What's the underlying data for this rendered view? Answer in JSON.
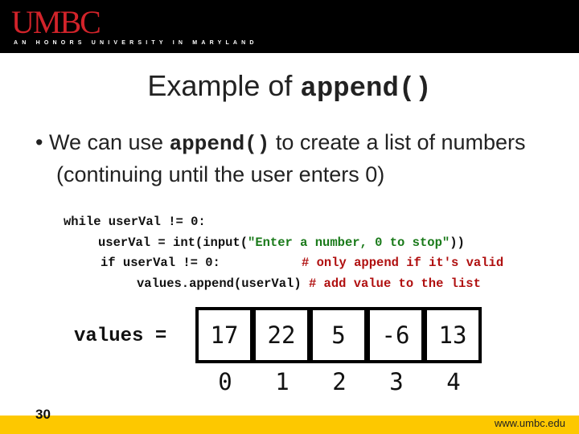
{
  "header": {
    "logo": "UMBC",
    "tagline": "AN HONORS UNIVERSITY IN MARYLAND",
    "brand_red": "#d2232a"
  },
  "title": {
    "text": "Example of ",
    "code": "append()"
  },
  "bullet": {
    "pre": "We can use ",
    "code": "append()",
    "post": " to create a list of numbers (continuing until the user enters 0)"
  },
  "code": {
    "line1": "while userVal != 0:",
    "line2a": "userVal = int(input(",
    "line2s": "\"Enter a number, 0 to stop\"",
    "line2b": "))",
    "line3": "if userVal != 0:",
    "line3c": "# only append if it's valid",
    "line4": "values.append(userVal) ",
    "line4c": "# add value to the list"
  },
  "list": {
    "label": "values =",
    "values": [
      "17",
      "22",
      "5",
      "-6",
      "13"
    ],
    "indices": [
      "0",
      "1",
      "2",
      "3",
      "4"
    ]
  },
  "footer": {
    "page": "30",
    "url": "www.umbc.edu",
    "color": "#fdc800"
  }
}
